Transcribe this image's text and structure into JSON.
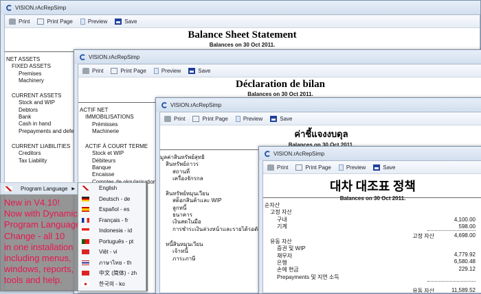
{
  "app_title": "VISION.rAcRepSimp",
  "toolbar": {
    "print": "Print",
    "print_page": "Print Page",
    "preview": "Preview",
    "save": "Save"
  },
  "windows": [
    {
      "title": "Balance Sheet Statement",
      "subtitle": "Balances on 30 Oct 2011.",
      "rows": [
        [
          "l1",
          "NET ASSETS"
        ],
        [
          "l2",
          "FIXED ASSETS"
        ],
        [
          "l3",
          "Premises"
        ],
        [
          "l3",
          "Machinery"
        ],
        [
          "gap",
          ""
        ],
        [
          "l2",
          "CURRENT ASSETS"
        ],
        [
          "l3",
          "Stock and WIP"
        ],
        [
          "l3",
          "Debtors"
        ],
        [
          "l3",
          "Bank"
        ],
        [
          "l3",
          "Cash in hand"
        ],
        [
          "l3",
          "Prepayments and deferred income"
        ],
        [
          "gap",
          ""
        ],
        [
          "l2",
          "CURRENT LIABILITIES"
        ],
        [
          "l3",
          "Creditors"
        ],
        [
          "l3",
          "Tax Liability"
        ]
      ]
    },
    {
      "title": "Déclaration de bilan",
      "subtitle": "Balances on 30 Oct 2011.",
      "rows": [
        [
          "l1",
          "ACTIF NET"
        ],
        [
          "l2",
          "IMMOBILISATIONS"
        ],
        [
          "l3",
          "Prémisses"
        ],
        [
          "l3",
          "Machinerie"
        ],
        [
          "gap",
          ""
        ],
        [
          "l2",
          "ACTIF À COURT TERME"
        ],
        [
          "l3",
          "Stock et WIP"
        ],
        [
          "l3",
          "Débiteurs"
        ],
        [
          "l3",
          "Banque"
        ],
        [
          "l3",
          "Encaisse"
        ],
        [
          "l3",
          "Comptes de régularisation"
        ]
      ]
    },
    {
      "title": "ค่าชี้แจงงบดุล",
      "subtitle": "Balances on 30 Oct 2011.",
      "rows": [
        [
          "l1",
          "มูลค่าสินทรัพย์สุทธิ"
        ],
        [
          "l2",
          "สินทรัพย์ถาวร"
        ],
        [
          "l3",
          "สถานที่"
        ],
        [
          "l3",
          "เครื่องจักรกล"
        ],
        [
          "gap",
          ""
        ],
        [
          "l2",
          "สินทรัพย์หมุนเวียน"
        ],
        [
          "l3",
          "สต็อกสินค้าและ WIP"
        ],
        [
          "l3",
          "ลูกหนี้"
        ],
        [
          "l3",
          "ธนาคาร"
        ],
        [
          "l3",
          "เงินสดในมือ"
        ],
        [
          "l3",
          "การชำระเงินล่วงหน้าและรายได้รอตัดบัญชี"
        ],
        [
          "gap",
          ""
        ],
        [
          "l2",
          "หนี้สินหมุนเวียน"
        ],
        [
          "l3",
          "เจ้าหนี้"
        ],
        [
          "l3",
          "ภาระภาษี"
        ]
      ]
    },
    {
      "title": "대차 대조표 정책",
      "subtitle": "Balances on 30 Oct 2011.",
      "rows": [
        [
          "l1",
          "순자산"
        ],
        [
          "l2",
          "고정 자산"
        ],
        [
          "l3",
          "구내"
        ],
        [
          "l3",
          "기계"
        ],
        [
          "gap",
          ""
        ],
        [
          "l2",
          "유동 자산"
        ],
        [
          "l3",
          "증권 및 WIP"
        ],
        [
          "l3",
          "채무자"
        ],
        [
          "l3",
          "은행"
        ],
        [
          "l3",
          "손에 현금"
        ],
        [
          "l3",
          "Prepayments 및 지연 소득"
        ]
      ]
    }
  ],
  "korean_values": {
    "premises": "4,100.00",
    "machinery": "598.00",
    "fixed_total_label": "고정 자산",
    "fixed_total": "4,698.00",
    "debtors": "4,779.92",
    "bank": "6,580.48",
    "cash": "229.12",
    "current_total_label": "유동 자산",
    "current_total": "11,589.52"
  },
  "menu": {
    "item": "Program Language",
    "promo": [
      "New in V4.10!",
      "Now with Dynamic",
      "Program Language",
      "Change - all 10",
      "in one installation",
      "including menus,",
      "windows, reports,",
      "tools and help."
    ]
  },
  "languages": [
    {
      "label": "English",
      "flag": "gb"
    },
    {
      "label": "Deutsch - de",
      "flag": "de"
    },
    {
      "label": "Español - es",
      "flag": "es"
    },
    {
      "label": "Français - fr",
      "flag": "fr"
    },
    {
      "label": "Indonesia - id",
      "flag": "id"
    },
    {
      "label": "Português - pt",
      "flag": "pt"
    },
    {
      "label": "Việt - vi",
      "flag": "vn"
    },
    {
      "label": "ภาษาไทย - th",
      "flag": "th"
    },
    {
      "label": "中文 (简体) - zh",
      "flag": "cn"
    },
    {
      "label": "한국의 - ko",
      "flag": "kr"
    }
  ]
}
